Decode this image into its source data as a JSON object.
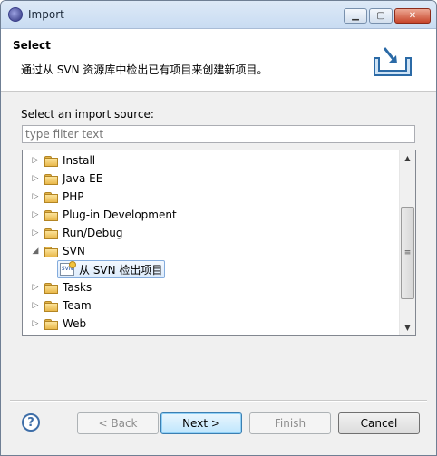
{
  "window": {
    "title": "Import"
  },
  "header": {
    "title": "Select",
    "description": "通过从 SVN 资源库中检出已有项目来创建新项目。"
  },
  "content": {
    "source_label": "Select an import source:",
    "filter_placeholder": "type filter text",
    "tree": [
      {
        "label": "Install",
        "expanded": false,
        "icon": "folder-icon"
      },
      {
        "label": "Java EE",
        "expanded": false,
        "icon": "folder-icon"
      },
      {
        "label": "PHP",
        "expanded": false,
        "icon": "folder-icon"
      },
      {
        "label": "Plug-in Development",
        "expanded": false,
        "icon": "folder-icon"
      },
      {
        "label": "Run/Debug",
        "expanded": false,
        "icon": "folder-icon"
      },
      {
        "label": "SVN",
        "expanded": true,
        "icon": "folder-icon"
      },
      {
        "label": "从 SVN 检出项目",
        "child": true,
        "selected": true,
        "icon": "svn-checkout-icon"
      },
      {
        "label": "Tasks",
        "expanded": false,
        "icon": "folder-icon"
      },
      {
        "label": "Team",
        "expanded": false,
        "icon": "folder-icon"
      },
      {
        "label": "Web",
        "expanded": false,
        "icon": "folder-icon"
      }
    ]
  },
  "buttons": {
    "help": "?",
    "back": "< Back",
    "next": "Next >",
    "finish": "Finish",
    "cancel": "Cancel"
  },
  "colors": {
    "selection": "#dcebfc",
    "default_button": "#bee6fd"
  }
}
